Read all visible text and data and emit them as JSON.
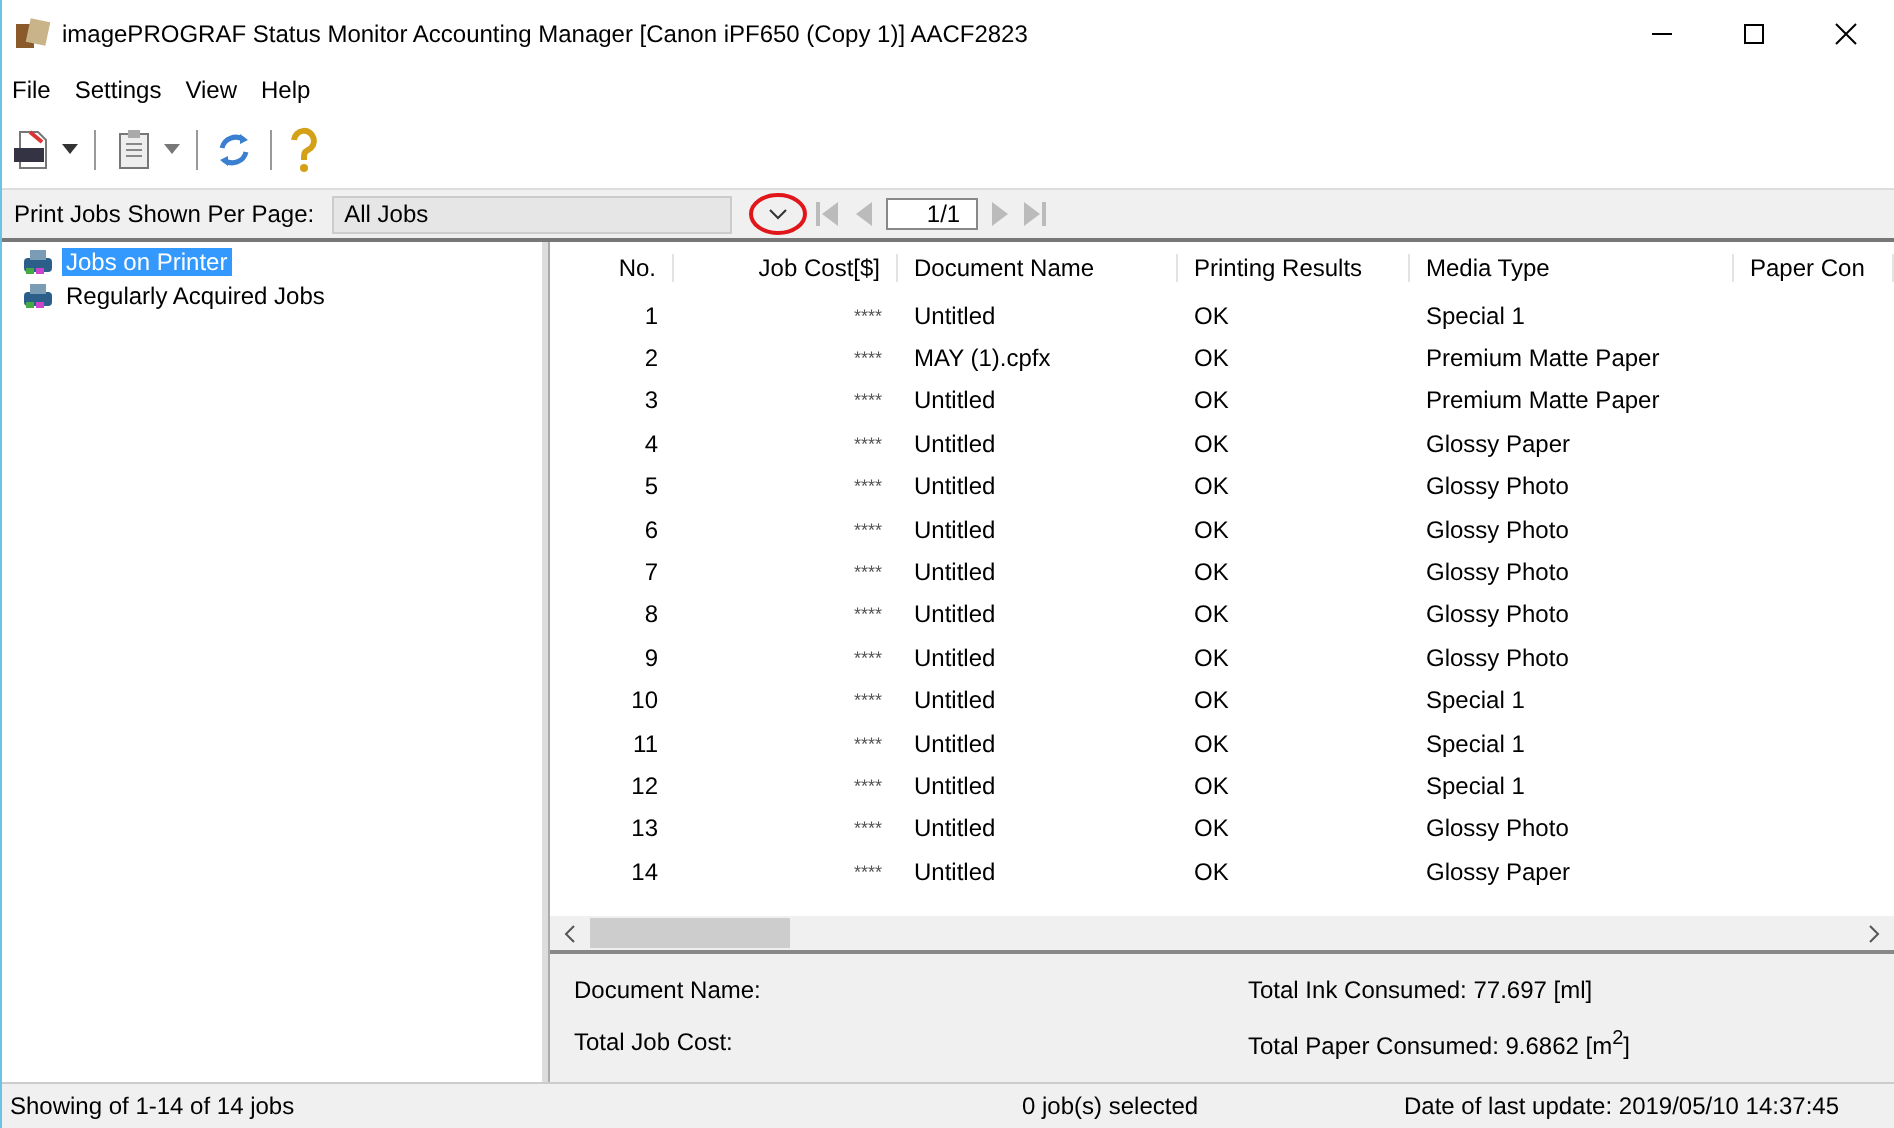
{
  "window": {
    "title": "imagePROGRAF Status Monitor Accounting Manager [Canon iPF650 (Copy 1)]  AACF2823"
  },
  "menu": [
    "File",
    "Settings",
    "View",
    "Help"
  ],
  "filter": {
    "label": "Print Jobs Shown Per Page:",
    "value": "All Jobs",
    "page": "1/1"
  },
  "tree": [
    {
      "label": "Jobs on Printer",
      "selected": true
    },
    {
      "label": "Regularly Acquired Jobs",
      "selected": false
    }
  ],
  "table": {
    "columns": [
      "No.",
      "Job Cost[$]",
      "Document Name",
      "Printing Results",
      "Media Type",
      "Paper Con"
    ],
    "rows": [
      [
        "1",
        "****",
        "Untitled",
        "OK",
        "Special 1"
      ],
      [
        "2",
        "****",
        "MAY (1).cpfx",
        "OK",
        "Premium Matte Paper"
      ],
      [
        "3",
        "****",
        "Untitled",
        "OK",
        "Premium Matte Paper"
      ],
      [
        "4",
        "****",
        "Untitled",
        "OK",
        "Glossy Paper"
      ],
      [
        "5",
        "****",
        "Untitled",
        "OK",
        "Glossy Photo"
      ],
      [
        "6",
        "****",
        "Untitled",
        "OK",
        "Glossy Photo"
      ],
      [
        "7",
        "****",
        "Untitled",
        "OK",
        "Glossy Photo"
      ],
      [
        "8",
        "****",
        "Untitled",
        "OK",
        "Glossy Photo"
      ],
      [
        "9",
        "****",
        "Untitled",
        "OK",
        "Glossy Photo"
      ],
      [
        "10",
        "****",
        "Untitled",
        "OK",
        "Special 1"
      ],
      [
        "11",
        "****",
        "Untitled",
        "OK",
        "Special 1"
      ],
      [
        "12",
        "****",
        "Untitled",
        "OK",
        "Special 1"
      ],
      [
        "13",
        "****",
        "Untitled",
        "OK",
        "Glossy Photo"
      ],
      [
        "14",
        "****",
        "Untitled",
        "OK",
        "Glossy Paper"
      ]
    ]
  },
  "details": {
    "document_name": "Document Name:",
    "total_job_cost": "Total Job Cost:",
    "ink": "Total Ink Consumed: 77.697 [ml]",
    "paper": "Total Paper Consumed: 9.6862 [m$^{2}$]"
  },
  "status_bar": [
    "Showing of 1-14 of 14 jobs",
    "0 job(s) selected",
    "Date of last update: 2019/05/10 14:37:45"
  ]
}
